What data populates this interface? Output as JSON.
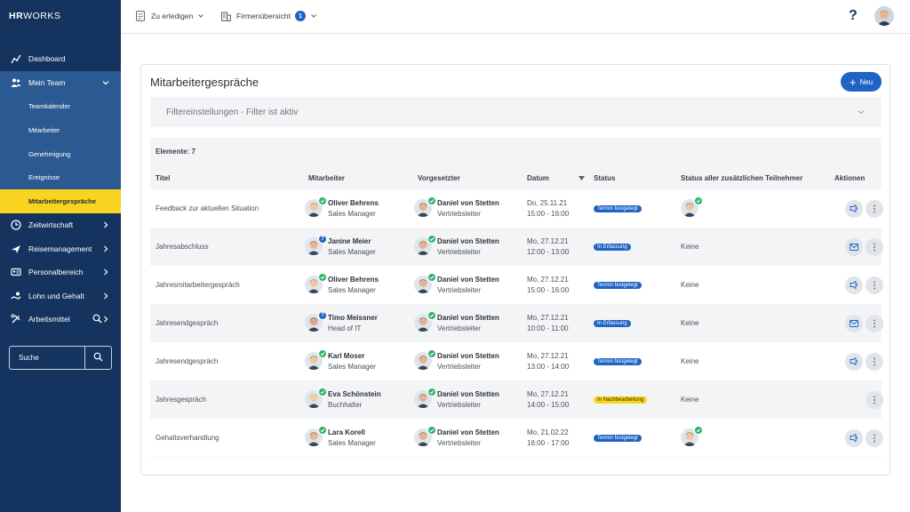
{
  "app": {
    "logo_bold": "HR",
    "logo_light": "WORKS"
  },
  "sidebar": {
    "items": [
      {
        "label": "Dashboard",
        "icon": "dashboard-icon"
      },
      {
        "label": "Mein Team",
        "icon": "team-icon"
      },
      {
        "label": "Zeitwirtschaft",
        "icon": "clock-icon"
      },
      {
        "label": "Reisemanagement",
        "icon": "plane-icon"
      },
      {
        "label": "Personalbereich",
        "icon": "id-card-icon"
      },
      {
        "label": "Lohn und Gehalt",
        "icon": "money-icon"
      },
      {
        "label": "Arbeitsmittel",
        "icon": "tools-icon"
      }
    ],
    "sub_items": [
      {
        "label": "Teamkalender"
      },
      {
        "label": "Mitarbeiter"
      },
      {
        "label": "Genehmigung"
      },
      {
        "label": "Ereignisse"
      },
      {
        "label": "Mitarbeitergespräche"
      }
    ],
    "search_placeholder": "Suche"
  },
  "topbar": {
    "todo_label": "Zu erledigen",
    "company_label": "Firmenübersicht",
    "company_badge": "1",
    "help_label": "?"
  },
  "main": {
    "title": "Mitarbeitergespräche",
    "new_button": "Neu",
    "filter_label": "Filtereinstellungen - Filter ist aktiv",
    "count_label": "Elemente: 7",
    "columns": {
      "titel": "Titel",
      "mitarbeiter": "Mitarbeiter",
      "vorgesetzter": "Vorgesetzter",
      "datum": "Datum",
      "status": "Status",
      "teilnehmer": "Status aller zusätzlichen Teilnehmer",
      "aktionen": "Aktionen"
    },
    "rows": [
      {
        "title": "Feedback zur aktuellen Situation",
        "emp_name": "Oliver Behrens",
        "emp_role": "Sales Manager",
        "emp_mark": "ok",
        "sup_name": "Daniel von Stetten",
        "sup_role": "Vertriebsleiter",
        "date": "Do, 25.11.21",
        "time": "15:00 - 16:00",
        "status": "Termin festgelegt",
        "status_color": "#1f64c4",
        "participants": "",
        "participant_avatar": true,
        "actions": [
          "video-icon",
          "more-icon"
        ]
      },
      {
        "title": "Jahresabschluss",
        "emp_name": "Janine Meier",
        "emp_role": "Sales Manager",
        "emp_mark": "q",
        "sup_name": "Daniel von Stetten",
        "sup_role": "Vertriebsleiter",
        "date": "Mo, 27.12.21",
        "time": "12:00 - 13:00",
        "status": "In Erfassung",
        "status_color": "#1f64c4",
        "participants": "Keine",
        "participant_avatar": false,
        "actions": [
          "mail-icon",
          "more-icon"
        ]
      },
      {
        "title": "Jahresmitarbeitergespräch",
        "emp_name": "Oliver Behrens",
        "emp_role": "Sales Manager",
        "emp_mark": "ok",
        "sup_name": "Daniel von Stetten",
        "sup_role": "Vertriebsleiter",
        "date": "Mo, 27.12.21",
        "time": "15:00 - 16:00",
        "status": "Termin festgelegt",
        "status_color": "#1f64c4",
        "participants": "Keine",
        "participant_avatar": false,
        "actions": [
          "video-icon",
          "more-icon"
        ]
      },
      {
        "title": "Jahresendgespräch",
        "emp_name": "Timo Meissner",
        "emp_role": "Head of IT",
        "emp_mark": "q",
        "sup_name": "Daniel von Stetten",
        "sup_role": "Vertriebsleiter",
        "date": "Mo, 27.12.21",
        "time": "10:00 - 11:00",
        "status": "In Erfassung",
        "status_color": "#1f64c4",
        "participants": "Keine",
        "participant_avatar": false,
        "actions": [
          "mail-icon",
          "more-icon"
        ]
      },
      {
        "title": "Jahresendgespräch",
        "emp_name": "Karl Moser",
        "emp_role": "Sales Manager",
        "emp_mark": "ok",
        "sup_name": "Daniel von Stetten",
        "sup_role": "Vertriebsleiter",
        "date": "Mo, 27.12.21",
        "time": "13:00 - 14:00",
        "status": "Termin festgelegt",
        "status_color": "#1f64c4",
        "participants": "Keine",
        "participant_avatar": false,
        "actions": [
          "video-icon",
          "more-icon"
        ]
      },
      {
        "title": "Jahresgespräch",
        "emp_name": "Eva Schönstein",
        "emp_role": "Buchhalter",
        "emp_mark": "ok",
        "sup_name": "Daniel von Stetten",
        "sup_role": "Vertriebsleiter",
        "date": "Mo, 27.12.21",
        "time": "14:00 - 15:00",
        "status": "In Nachbearbeitung",
        "status_color": "#f8d31f",
        "participants": "Keine",
        "participant_avatar": false,
        "actions": [
          "more-icon"
        ]
      },
      {
        "title": "Gehaltsverhandlung",
        "emp_name": "Lara Korell",
        "emp_role": "Sales Manager",
        "emp_mark": "ok",
        "sup_name": "Daniel von Stetten",
        "sup_role": "Vertriebsleiter",
        "date": "Mo, 21.02.22",
        "time": "16:00 - 17:00",
        "status": "Termin festgelegt",
        "status_color": "#1f64c4",
        "participants": "",
        "participant_avatar": true,
        "actions": [
          "video-icon",
          "more-icon"
        ]
      }
    ]
  }
}
